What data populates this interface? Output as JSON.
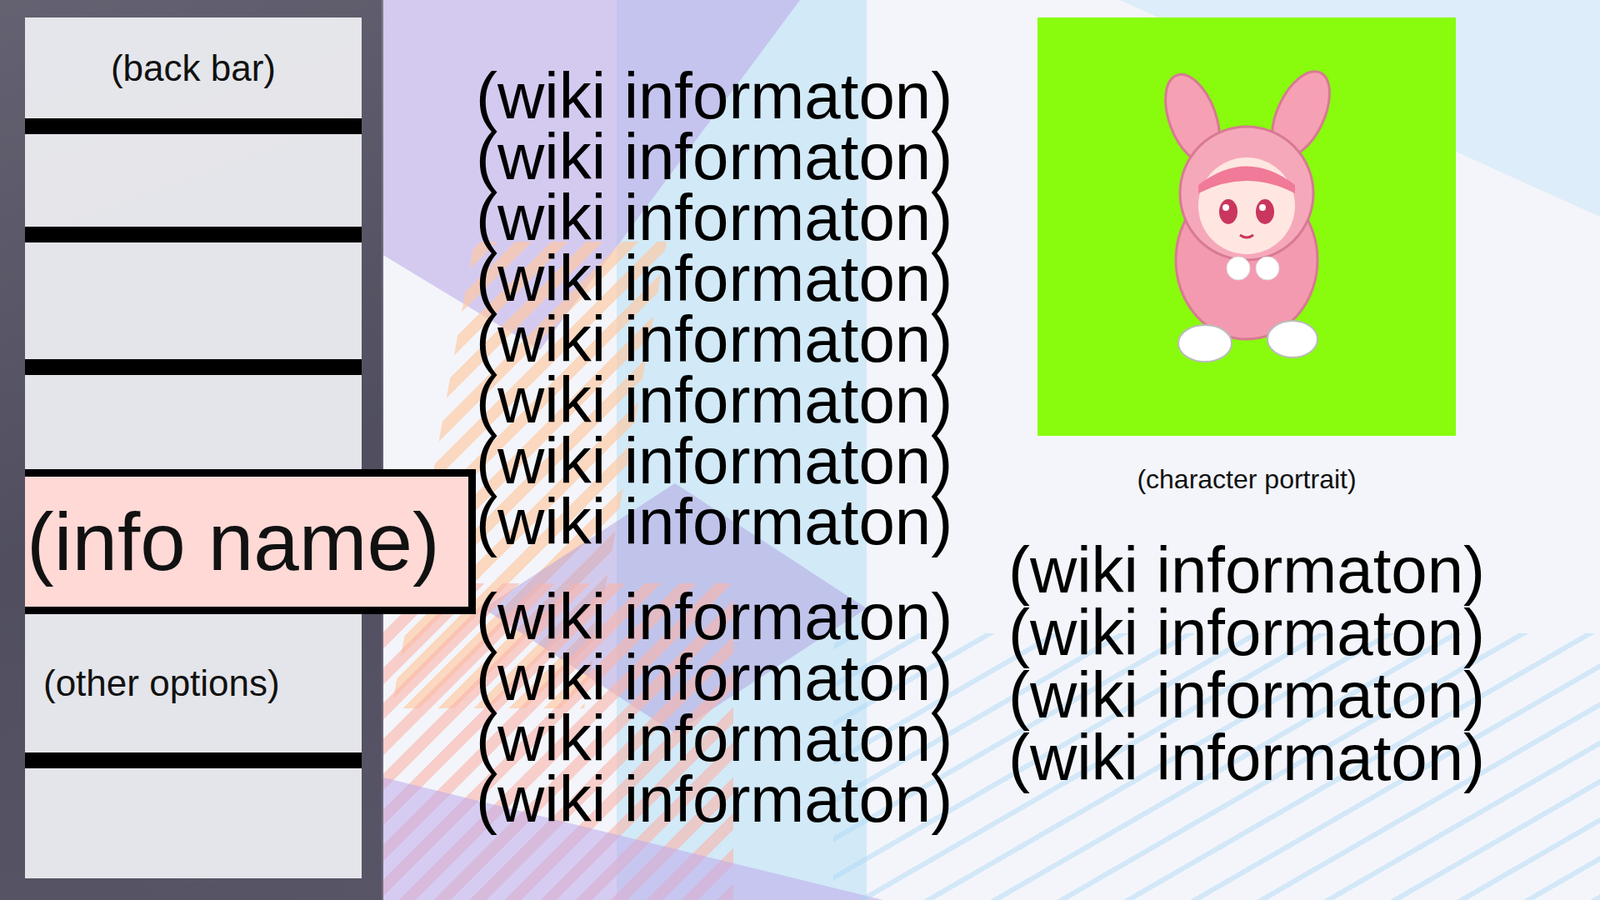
{
  "sidebar": {
    "items": [
      {
        "kind": "back",
        "label": "(back bar)",
        "selected": false
      },
      {
        "kind": "blank",
        "selected": false
      },
      {
        "kind": "blank",
        "selected": false
      },
      {
        "kind": "blank",
        "selected": false
      },
      {
        "kind": "option",
        "label": "(info name)",
        "selected": true
      },
      {
        "kind": "option",
        "label": "(other options)",
        "selected": false
      },
      {
        "kind": "blank",
        "selected": false
      }
    ]
  },
  "wiki": {
    "main_groups": [
      [
        "(wiki informaton)",
        "(wiki informaton)",
        "(wiki informaton)",
        "(wiki informaton)",
        "(wiki informaton)",
        "(wiki informaton)",
        "(wiki informaton)",
        "(wiki informaton)"
      ],
      [
        "(wiki informaton)",
        "(wiki informaton)",
        "(wiki informaton)",
        "(wiki informaton)"
      ]
    ],
    "side": [
      "(wiki informaton)",
      "(wiki informaton)",
      "(wiki informaton)",
      "(wiki informaton)"
    ]
  },
  "portrait": {
    "caption": "(character portrait)"
  }
}
